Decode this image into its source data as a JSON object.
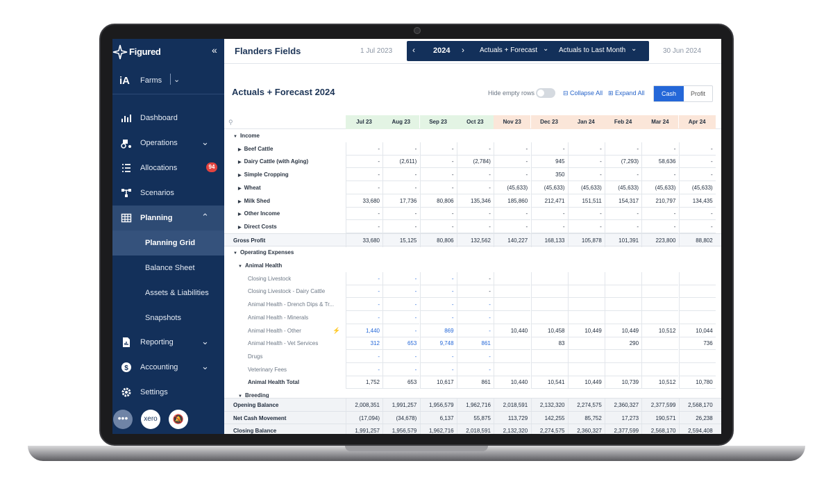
{
  "brand": {
    "name": "Figured"
  },
  "org": {
    "label": "Farms",
    "icon": "farm-org-icon"
  },
  "nav": {
    "items": [
      {
        "label": "Dashboard",
        "icon": "chart-icon"
      },
      {
        "label": "Operations",
        "icon": "tractor-icon"
      },
      {
        "label": "Allocations",
        "icon": "list-icon",
        "badge": "94"
      },
      {
        "label": "Scenarios",
        "icon": "flow-icon"
      },
      {
        "label": "Planning",
        "icon": "grid-icon"
      },
      {
        "label": "Reporting",
        "icon": "report-icon"
      },
      {
        "label": "Accounting",
        "icon": "dollar-icon"
      },
      {
        "label": "Settings",
        "icon": "gear-icon"
      }
    ],
    "planning_sub": [
      "Planning Grid",
      "Balance Sheet",
      "Assets & Liabilities",
      "Snapshots"
    ]
  },
  "topbar": {
    "farm_name": "Flanders Fields",
    "start_date": "1 Jul 2023",
    "end_date": "30 Jun 2024",
    "year": "2024",
    "mode": "Actuals + Forecast",
    "compare": "Actuals to Last Month"
  },
  "header": {
    "title": "Actuals + Forecast 2024",
    "hide_empty_label": "Hide empty rows",
    "collapse_all": "Collapse All",
    "expand_all": "Expand All",
    "cash": "Cash",
    "profit": "Profit"
  },
  "grid": {
    "months": [
      "Jul 23",
      "Aug 23",
      "Sep 23",
      "Oct 23",
      "Nov 23",
      "Dec 23",
      "Jan 24",
      "Feb 24",
      "Mar 24",
      "Apr 24"
    ],
    "rows": [
      {
        "name": "Income",
        "level": 0,
        "kind": "section",
        "values": []
      },
      {
        "name": "Beef Cattle",
        "level": 1,
        "kind": "bold",
        "values": [
          "-",
          "-",
          "-",
          "-",
          "-",
          "-",
          "-",
          "-",
          "-",
          "-"
        ]
      },
      {
        "name": "Dairy Cattle (with Aging)",
        "level": 1,
        "kind": "bold",
        "values": [
          "-",
          "(2,611)",
          "-",
          "(2,784)",
          "-",
          "945",
          "-",
          "(7,293)",
          "58,636",
          "-"
        ]
      },
      {
        "name": "Simple Cropping",
        "level": 1,
        "kind": "bold",
        "values": [
          "-",
          "-",
          "-",
          "-",
          "-",
          "350",
          "-",
          "-",
          "-",
          "-"
        ]
      },
      {
        "name": "Wheat",
        "level": 1,
        "kind": "bold",
        "values": [
          "-",
          "-",
          "-",
          "-",
          "(45,633)",
          "(45,633)",
          "(45,633)",
          "(45,633)",
          "(45,633)",
          "(45,633)"
        ]
      },
      {
        "name": "Milk Shed",
        "level": 1,
        "kind": "bold",
        "values": [
          "33,680",
          "17,736",
          "80,806",
          "135,346",
          "185,860",
          "212,471",
          "151,511",
          "154,317",
          "210,797",
          "134,435"
        ]
      },
      {
        "name": "Other Income",
        "level": 1,
        "kind": "bold",
        "values": [
          "-",
          "-",
          "-",
          "-",
          "-",
          "-",
          "-",
          "-",
          "-",
          "-"
        ]
      },
      {
        "name": "Direct Costs",
        "level": 1,
        "kind": "bold",
        "values": [
          "-",
          "-",
          "-",
          "-",
          "-",
          "-",
          "-",
          "-",
          "-",
          "-"
        ]
      },
      {
        "name": "Gross Profit",
        "level": 0,
        "kind": "total",
        "values": [
          "33,680",
          "15,125",
          "80,806",
          "132,562",
          "140,227",
          "168,133",
          "105,878",
          "101,391",
          "223,800",
          "88,802"
        ]
      },
      {
        "name": "Operating Expenses",
        "level": 0,
        "kind": "section",
        "values": []
      },
      {
        "name": "Animal Health",
        "level": 1,
        "kind": "section",
        "values": []
      },
      {
        "name": "Closing Livestock",
        "level": 2,
        "kind": "sub",
        "values": [
          "-",
          "-",
          "-",
          "-",
          "",
          "",
          "",
          "",
          "",
          ""
        ],
        "blue": [
          1,
          1,
          1,
          0,
          0,
          0,
          0,
          0,
          0,
          0
        ]
      },
      {
        "name": "Closing Livestock - Dairy Cattle",
        "level": 2,
        "kind": "sub",
        "values": [
          "-",
          "-",
          "-",
          "-",
          "",
          "",
          "",
          "",
          "",
          ""
        ],
        "blue": [
          1,
          1,
          1,
          0,
          0,
          0,
          0,
          0,
          0,
          0
        ]
      },
      {
        "name": "Animal Health - Drench Dips & Tr...",
        "level": 2,
        "kind": "sub",
        "values": [
          "-",
          "-",
          "-",
          "-",
          "",
          "",
          "",
          "",
          "",
          ""
        ],
        "blue": [
          1,
          1,
          1,
          1,
          0,
          0,
          0,
          0,
          0,
          0
        ]
      },
      {
        "name": "Animal Health - Minerals",
        "level": 2,
        "kind": "sub",
        "values": [
          "-",
          "-",
          "-",
          "-",
          "",
          "",
          "",
          "",
          "",
          ""
        ],
        "blue": [
          1,
          1,
          1,
          1,
          0,
          0,
          0,
          0,
          0,
          0
        ]
      },
      {
        "name": "Animal Health - Other",
        "level": 2,
        "kind": "sub",
        "bolt": true,
        "values": [
          "1,440",
          "-",
          "869",
          "-",
          "10,440",
          "10,458",
          "10,449",
          "10,449",
          "10,512",
          "10,044"
        ],
        "blue": [
          1,
          1,
          1,
          1,
          0,
          0,
          0,
          0,
          0,
          0
        ]
      },
      {
        "name": "Animal Health - Vet Services",
        "level": 2,
        "kind": "sub",
        "values": [
          "312",
          "653",
          "9,748",
          "861",
          "",
          "83",
          "",
          "290",
          "",
          "736"
        ],
        "blue": [
          1,
          1,
          1,
          1,
          0,
          0,
          0,
          0,
          0,
          0
        ]
      },
      {
        "name": "Drugs",
        "level": 2,
        "kind": "sub",
        "values": [
          "-",
          "-",
          "-",
          "-",
          "",
          "",
          "",
          "",
          "",
          ""
        ],
        "blue": [
          1,
          1,
          1,
          1,
          0,
          0,
          0,
          0,
          0,
          0
        ]
      },
      {
        "name": "Veterinary Fees",
        "level": 2,
        "kind": "sub",
        "values": [
          "-",
          "-",
          "-",
          "-",
          "",
          "",
          "",
          "",
          "",
          ""
        ],
        "blue": [
          1,
          1,
          1,
          1,
          0,
          0,
          0,
          0,
          0,
          0
        ]
      },
      {
        "name": "Animal Health Total",
        "level": 2,
        "kind": "bold",
        "values": [
          "1,752",
          "653",
          "10,617",
          "861",
          "10,440",
          "10,541",
          "10,449",
          "10,739",
          "10,512",
          "10,780"
        ]
      },
      {
        "name": "Breeding",
        "level": 1,
        "kind": "section",
        "values": []
      }
    ],
    "footer": [
      {
        "name": "Opening Balance",
        "values": [
          "2,008,351",
          "1,991,257",
          "1,956,579",
          "1,962,716",
          "2,018,591",
          "2,132,320",
          "2,274,575",
          "2,360,327",
          "2,377,599",
          "2,568,170"
        ]
      },
      {
        "name": "Net Cash Movement",
        "values": [
          "(17,094)",
          "(34,678)",
          "6,137",
          "55,875",
          "113,729",
          "142,255",
          "85,752",
          "17,273",
          "190,571",
          "26,238"
        ]
      },
      {
        "name": "Closing Balance",
        "values": [
          "1,991,257",
          "1,956,579",
          "1,962,716",
          "2,018,591",
          "2,132,320",
          "2,274,575",
          "2,360,327",
          "2,377,599",
          "2,568,170",
          "2,594,408"
        ]
      }
    ]
  },
  "colors": {
    "sidebar": "#13305a",
    "accent": "#2467d8",
    "actual_header": "#e3f4e4",
    "forecast_header": "#fbe6d9",
    "badge": "#e2433f"
  }
}
